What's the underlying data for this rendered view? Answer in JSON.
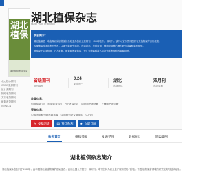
{
  "sidebar": {
    "items": [
      "北大核心期刊",
      "CSCD来源期刊",
      "统计源期刊",
      "知网收录期刊",
      "万方收录期刊",
      "维普收录期刊",
      "ISSN/CN"
    ]
  },
  "cover": {
    "title": "湖北植保",
    "publisher_line": "湖北省植物保护总站"
  },
  "journal": {
    "title": "湖北植保杂志",
    "subtitle": "Hubei Plant Protection"
  },
  "info": {
    "heading": "杂志简介：",
    "lines": [
      "湖北植保是一本由湖北省植物保护总站主办的农业类期刊，1988年创刊，双月刊。该刊以宣传贯彻国家有关植物保护方针政策，",
      "传播植保科学技术为宗旨，主要刊载病虫测报、防治技术、农药应用、植物检疫等方面的研究成果和实践经验。",
      "被收录于中国知网、万方数据、维普网等数据库，是广大植保科技人员交流学术经验的重要园地。"
    ]
  },
  "stats": [
    {
      "value": "省级期刊",
      "label": "期刊级别",
      "accent": "#d6262b"
    },
    {
      "value": "0.24",
      "label": "影响因子",
      "accent": "#333333"
    },
    {
      "value": "湖北",
      "label": "出版地区",
      "accent": "#333333"
    },
    {
      "value": "双月刊",
      "label": "出版周期",
      "accent": "#333333"
    }
  ],
  "database": {
    "heading": "收录信息：",
    "items": [
      "知网收录(中)",
      "维普收录(中)",
      "万方收录(中)",
      "国家图书馆馆藏",
      "上海图书馆馆藏"
    ]
  },
  "honor": {
    "heading": "荣誉信息：",
    "items": [
      "中国优秀期刊遴选数据库",
      "中国期刊全文数据库（CJFD）"
    ]
  },
  "buttons": {
    "submit": {
      "label": "投稿咨询",
      "color": "#d6262b"
    },
    "subscribe": {
      "label": "预订杂志",
      "color": "#1a5fb4"
    },
    "consult": {
      "label": "立即订阅",
      "color": "#1a5fb4"
    }
  },
  "tabs": [
    "杂志首页",
    "投稿须知",
    "发表范围",
    "数据统计",
    "同类期刊"
  ],
  "intro": {
    "title": "湖北植保杂志简介",
    "text": "湖北植保杂志创刊于1988年，由中国湖北省植物保护总站主办，面向全国公开发行，双月刊。本刊坚持为农业生产服务的办刊宗旨，刊登植物保护领域的研究论文与技术经验。"
  },
  "colors": {
    "primary": "#1a5fb4",
    "danger": "#d6262b",
    "cover_green": "#6a8d3a"
  }
}
